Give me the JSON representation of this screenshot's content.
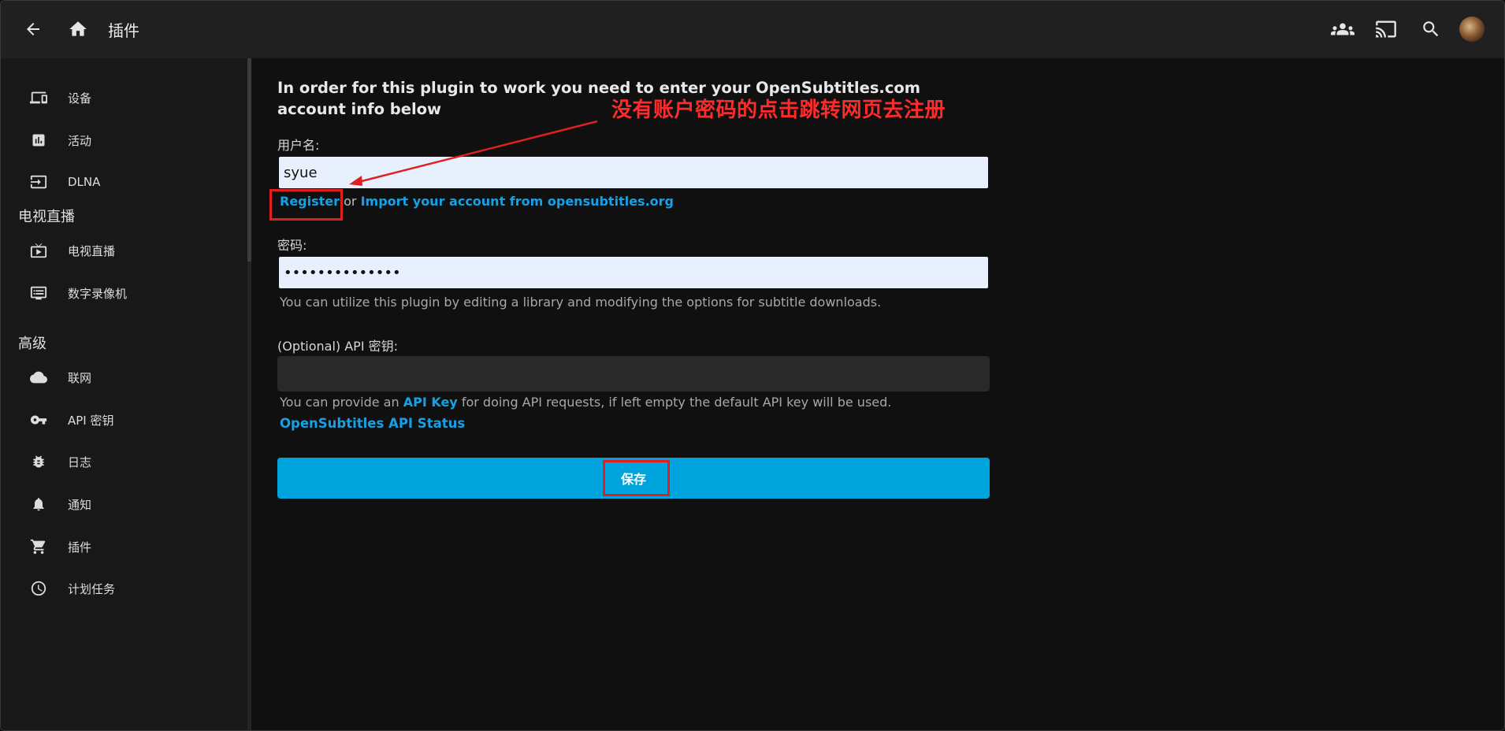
{
  "header": {
    "title": "插件",
    "icons": [
      "back-arrow-icon",
      "home-icon",
      "users-icon",
      "cast-icon",
      "search-icon",
      "avatar"
    ]
  },
  "sidebar": {
    "items_top": [
      {
        "label": "设备",
        "icon": "devices-icon"
      },
      {
        "label": "活动",
        "icon": "activity-chart-icon"
      },
      {
        "label": "DLNA",
        "icon": "dlna-input-icon"
      }
    ],
    "section_livetv": "电视直播",
    "items_livetv": [
      {
        "label": "电视直播",
        "icon": "live-tv-icon"
      },
      {
        "label": "数字录像机",
        "icon": "dvr-icon"
      }
    ],
    "section_advanced": "高级",
    "items_advanced": [
      {
        "label": "联网",
        "icon": "cloud-icon"
      },
      {
        "label": "API 密钥",
        "icon": "key-icon"
      },
      {
        "label": "日志",
        "icon": "bug-icon"
      },
      {
        "label": "通知",
        "icon": "bell-icon"
      },
      {
        "label": "插件",
        "icon": "cart-icon"
      },
      {
        "label": "计划任务",
        "icon": "clock-icon"
      }
    ]
  },
  "main": {
    "intro": "In order for this plugin to work you need to enter your OpenSubtitles.com account info below",
    "username_label": "用户名:",
    "username_value": "syue",
    "register_link": "Register",
    "or_text": " or ",
    "import_link": "Import your account from opensubtitles.org",
    "password_label": "密码:",
    "password_value": "••••••••••••••",
    "password_help": "You can utilize this plugin by editing a library and modifying the options for subtitle downloads.",
    "apikey_label": "(Optional) API 密钥:",
    "apikey_value": "",
    "apikey_help_pre": "You can provide an ",
    "apikey_help_link": "API Key",
    "apikey_help_post": " for doing API requests, if left empty the default API key will be used.",
    "status_link": "OpenSubtitles API Status",
    "save_button": "保存"
  },
  "annotation": {
    "text": "没有账户密码的点击跳转网页去注册",
    "color": "#ff2b2b"
  },
  "colors": {
    "accent": "#00a4dc",
    "link": "#16a1e6",
    "background": "#101010",
    "header": "#202020"
  }
}
